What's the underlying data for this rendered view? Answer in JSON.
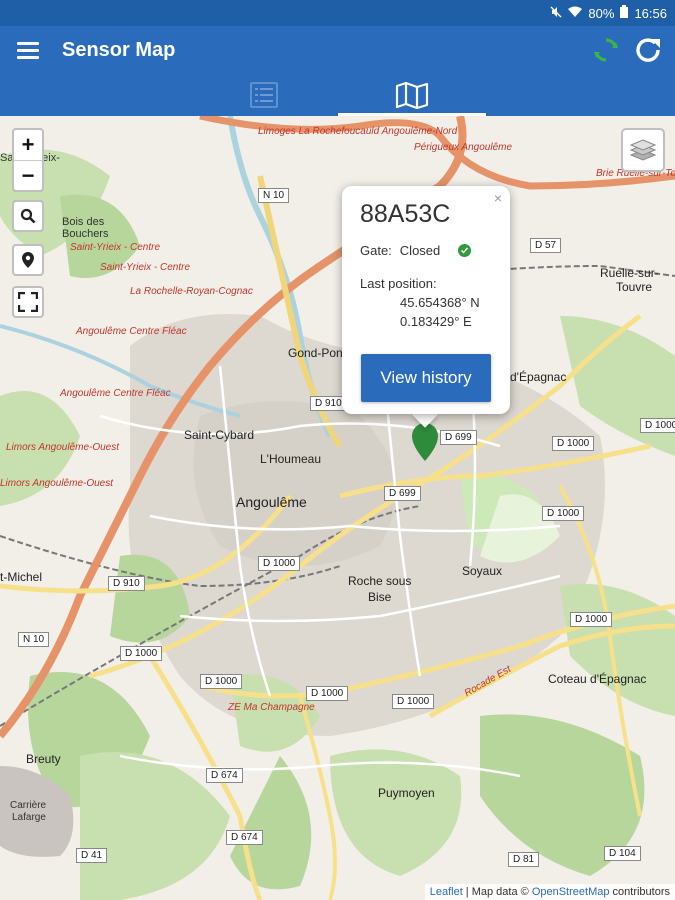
{
  "status_bar": {
    "battery": "80%",
    "time": "16:56"
  },
  "app_bar": {
    "title": "Sensor Map"
  },
  "tabs": [
    {
      "name": "list",
      "icon": "list-icon"
    },
    {
      "name": "map",
      "icon": "map-icon",
      "active": true
    }
  ],
  "map": {
    "zoom_in_label": "+",
    "zoom_out_label": "−",
    "labels": {
      "saint_yrieix": "Saint-Yrieix-",
      "bois_des": "Bois des",
      "bouchers": "Bouchers",
      "gond_pontouvre": "Gond-Pont",
      "saint_cybard": "Saint-Cybard",
      "l_houmeau": "L'Houmeau",
      "angouleme": "Angoulême",
      "saint_michel": "t-Michel",
      "roche_sous_bise": "Roche sous",
      "bise": "Bise",
      "soyaux": "Soyaux",
      "coteau_epagnac": "Coteau d'Épagnac",
      "d_epagnac": "d'Épagnac",
      "ruelle": "Ruelle-sur-",
      "touvre": "Touvre",
      "breuty": "Breuty",
      "puymoyen": "Puymoyen",
      "carriere": "Carrière",
      "lafarge": "Lafarge"
    },
    "red_labels": {
      "limoges_la_roche": "Limoges La Rochefoucauld Angoulême-Nord",
      "saint_yrieix_centre": "Saint-Yrieix - Centre",
      "saint_yrieix_centre2": "Saint-Yrieix - Centre",
      "la_rochelle": "La Rochelle-Royan-Cognac",
      "angouleme_centre_fleac": "Angoulême Centre Fléac",
      "angouleme_centre_fleac2": "Angoulême Centre Fléac",
      "limors_angouleme_ouest": "Limors Angoulême-Ouest",
      "limors_angouleme_ouest2": "Limors Angoulême-Ouest",
      "perigueux": "Périgueux Angoulême",
      "brie_ruelle": "Brie Ruelle-sur-Touvre",
      "ze_ma_champagne": "ZE Ma Champagne",
      "rocade_est": "Rocade Est"
    },
    "roads": {
      "n10_top": "N 10",
      "d57": "D 57",
      "d910_center": "D 910",
      "d699_a": "D 699",
      "d699_b": "D 699",
      "d1000_a": "D 1000",
      "d1000_b": "D 1000",
      "d1000_c": "D 1000",
      "d1000_d": "D 1000",
      "d1000_e": "D 1000",
      "d1000_f": "D 1000",
      "d1000_g": "D 1000",
      "d1000_h": "D 1000",
      "d1000_i": "D 1000",
      "d910_left": "D 910",
      "n10_left": "N 10",
      "d674_a": "D 674",
      "d674_b": "D 674",
      "d41": "D 41",
      "d81": "D 81",
      "d104": "D 104"
    }
  },
  "popup": {
    "sensor_id": "88A53C",
    "close_label": "×",
    "gate_label": "Gate:",
    "gate_value": "Closed",
    "last_position_label": "Last position:",
    "latitude": "45.654368° N",
    "longitude": "0.183429° E",
    "view_history_label": "View history"
  },
  "attribution": {
    "leaflet": "Leaflet",
    "separator": " | Map data © ",
    "osm": "OpenStreetMap",
    "contributors": " contributors"
  },
  "colors": {
    "primary": "#2a6cbb",
    "status": "#1e5fa8",
    "marker": "#2e8b3c",
    "refresh_green": "#38b44a"
  }
}
